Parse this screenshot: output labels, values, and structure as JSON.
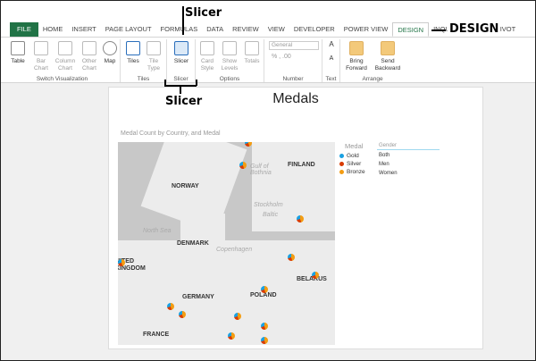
{
  "tabs": [
    "FILE",
    "HOME",
    "INSERT",
    "PAGE LAYOUT",
    "FORMULAS",
    "DATA",
    "REVIEW",
    "VIEW",
    "DEVELOPER",
    "POWER VIEW",
    "DESIGN",
    "INQUIRE",
    "POWERPIVOT"
  ],
  "ribbon": {
    "switch_visualization": {
      "label": "Switch Visualization",
      "buttons": [
        "Table",
        "Bar Chart",
        "Column Chart",
        "Other Chart",
        "Map"
      ]
    },
    "tiles": {
      "label": "Tiles",
      "buttons": [
        "Tiles",
        "Tile Type"
      ]
    },
    "slicer": {
      "label": "Slicer",
      "buttons": [
        "Slicer"
      ]
    },
    "options": {
      "label": "Options",
      "buttons": [
        "Card Style",
        "Show Levels",
        "Totals"
      ]
    },
    "number": {
      "label": "Number",
      "format": "General",
      "symbols": "% , .00"
    },
    "text": {
      "label": "Text",
      "buttons": [
        "A",
        "A"
      ]
    },
    "arrange": {
      "label": "Arrange",
      "buttons": [
        "Bring Forward",
        "Send Backward"
      ]
    }
  },
  "report": {
    "title": "Medals",
    "chart_title": "Medal Count by Country, and Medal",
    "legend": {
      "title": "Medal",
      "items": [
        {
          "label": "Gold",
          "color": "#1aa1e2"
        },
        {
          "label": "Silver",
          "color": "#d83b01"
        },
        {
          "label": "Bronze",
          "color": "#f39c12"
        }
      ]
    },
    "slicer": {
      "header": "Gender",
      "items": [
        "Both",
        "Men",
        "Women"
      ]
    },
    "map_labels": [
      "NORWAY",
      "FINLAND",
      "DENMARK",
      "GERMANY",
      "POLAND",
      "BELARUS",
      "North Sea",
      "Gulf of Bothnia",
      "Copenhagen",
      "Stockholm",
      "NITED KINGDOM",
      "FRANCE",
      "Baltic"
    ]
  },
  "annotations": {
    "slicer_top": "Slicer",
    "slicer_bottom": "Slicer",
    "design": "DESIGN"
  }
}
